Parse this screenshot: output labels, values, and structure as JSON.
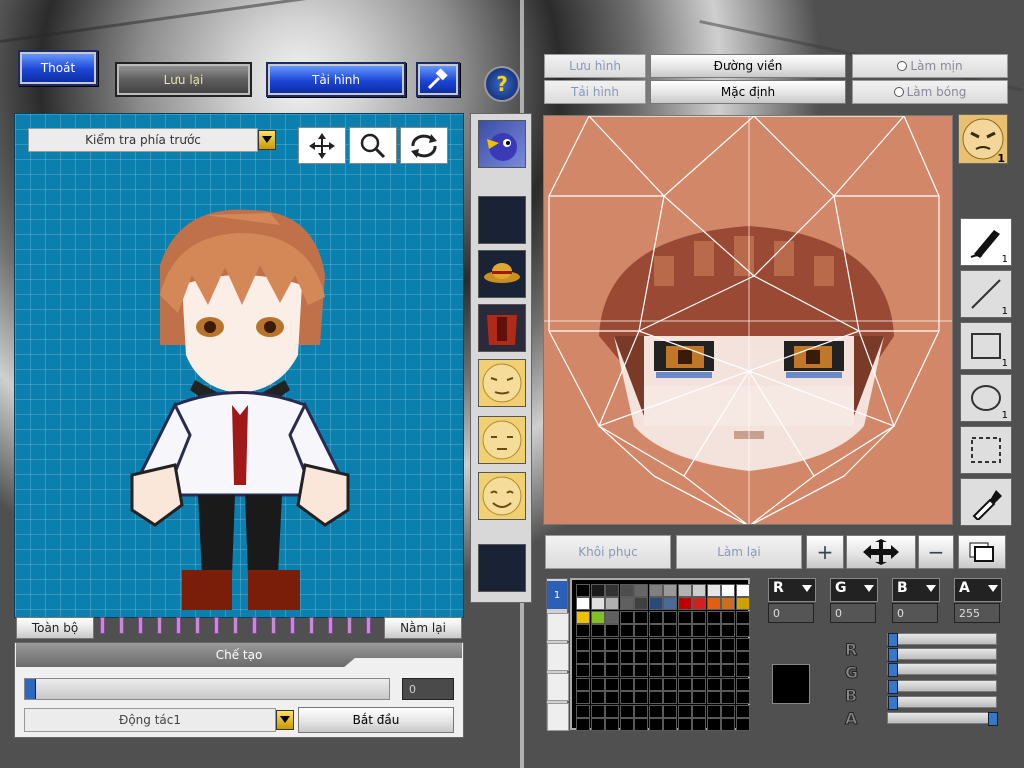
{
  "top_buttons": {
    "exit": "Thoát",
    "save": "Lưu lại",
    "reload": "Tải hình"
  },
  "left": {
    "view_dropdown": "Kiểm tra phía trước",
    "all_label": "Toàn bộ",
    "lie_down_label": "Nằm lại"
  },
  "craft": {
    "title": "Chế tạo",
    "progress_value": "0",
    "action_dropdown": "Động tác1",
    "start_label": "Bắt đầu"
  },
  "right_header": {
    "save": "Lưu hình",
    "load": "Tải hình",
    "outline": "Đường viền",
    "default": "Mặc định",
    "smooth": "Làm mịn",
    "shade": "Làm bóng"
  },
  "editor_buttons": {
    "restore": "Khôi phục",
    "redo": "Làm lại"
  },
  "tools": [
    {
      "name": "pen",
      "count": "1"
    },
    {
      "name": "line",
      "count": "1"
    },
    {
      "name": "rect",
      "count": "1"
    },
    {
      "name": "ellipse",
      "count": "1"
    },
    {
      "name": "select",
      "count": ""
    },
    {
      "name": "eyedropper",
      "count": ""
    }
  ],
  "color_channels": {
    "r_label": "R",
    "g_label": "G",
    "b_label": "B",
    "a_label": "A",
    "r": "0",
    "g": "0",
    "b": "0",
    "a": "255"
  },
  "palette_colors": [
    "#000000",
    "#1a1a1a",
    "#333333",
    "#4d4d4d",
    "#666666",
    "#808080",
    "#999999",
    "#b3b3b3",
    "#cccccc",
    "#e6e6e6",
    "#ffffff",
    "#ffffff",
    "#ffffff",
    "#e0e0e0",
    "#b0b0b0",
    "#606060",
    "#404040",
    "#2a4a7a",
    "#4a6a9a",
    "#c00000",
    "#d02020",
    "#e06010",
    "#c87020",
    "#d0a000",
    "#f0c000",
    "#80c020",
    "#606060"
  ],
  "current_color": "#000000",
  "colors": {
    "grid_blue": "#0b7fae",
    "canvas_bg": "#d28868",
    "accent_blue": "#1b45d6"
  }
}
